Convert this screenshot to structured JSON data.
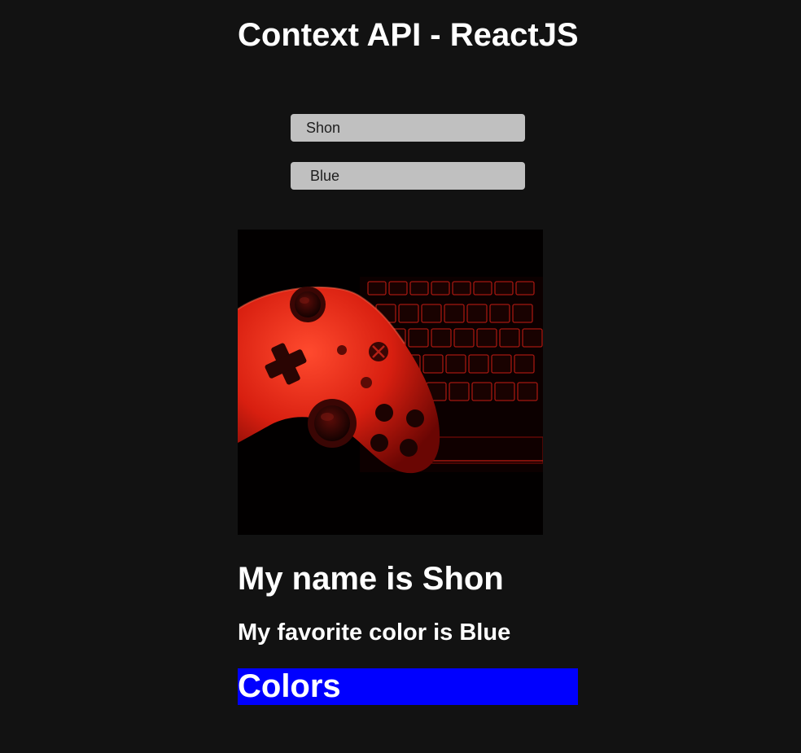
{
  "header": {
    "title": "Context API - ReactJS"
  },
  "form": {
    "name_value": "Shon",
    "color_value": "Blue"
  },
  "image": {
    "alt": "Red game controller on a backlit keyboard"
  },
  "profile": {
    "name_line": "My name is Shon",
    "color_line": "My favorite color is Blue"
  },
  "colors_banner": {
    "label": "Colors",
    "background": "#0000ff",
    "text_color": "#ffffff"
  },
  "theme": {
    "page_background": "#121212",
    "input_background": "#c0c0c0",
    "text": "#ffffff"
  }
}
